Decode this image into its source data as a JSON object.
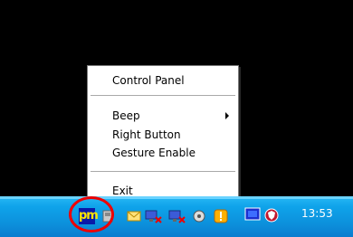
{
  "menu": {
    "items": [
      {
        "label": "Control Panel"
      },
      {
        "label": "Beep"
      },
      {
        "label": "Right Button"
      },
      {
        "label": "Gesture Enable"
      },
      {
        "label": "Exit"
      }
    ]
  },
  "tray": {
    "app_icon_label": "pm",
    "clock": "13:53",
    "icons": [
      "pm-icon",
      "usb-icon",
      "mail-icon",
      "network-disconnected-icon",
      "network-disconnected-icon",
      "speaker-icon",
      "warning-icon",
      "monitor-icon",
      "shield-icon"
    ]
  },
  "colors": {
    "taskbar": "#0c8fdb",
    "highlight_circle": "#e00000",
    "app_icon_bg": "#0a1aa8",
    "app_icon_fg": "#ffe500"
  }
}
